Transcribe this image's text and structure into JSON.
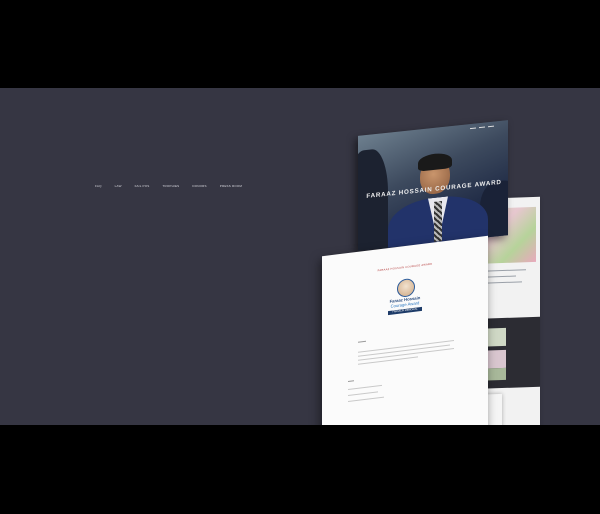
{
  "menu": {
    "items": [
      "FAQ",
      "LAW",
      "FAIL POS",
      "TROPHIES",
      "DONORS",
      "PRESS ROOM"
    ]
  },
  "hero": {
    "title": "FARAAZ HOSSAIN COURAGE AWARD"
  },
  "document": {
    "heading": "FARAAZ HOSSAIN COURAGE AWARD",
    "award_line1": "Faraaz Hossain",
    "award_line2": "Courage Award",
    "award_line3": "FRANKLIN MEMORIAL"
  },
  "colors": {
    "background": "#000000",
    "stage": "#363643",
    "accent_red": "#b03030",
    "award_blue": "#2a4d80"
  }
}
